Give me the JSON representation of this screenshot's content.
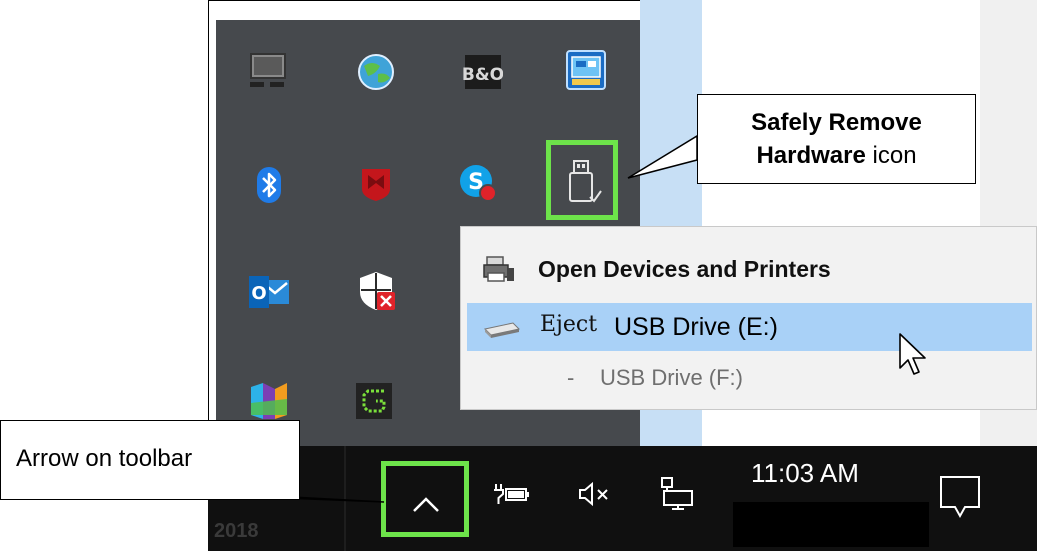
{
  "tray": {
    "icons": [
      "monitor-icon",
      "globe-icon",
      "bo-audio-icon",
      "intel-graphics-icon",
      "bluetooth-icon",
      "mcafee-icon",
      "skype-icon",
      "usb-drive-icon",
      "outlook-icon",
      "security-shield-icon",
      "maps-icon",
      "greenshot-icon"
    ],
    "bo_text": "B&O",
    "outlook_text": "O"
  },
  "menu": {
    "open_devices_label": "Open Devices and Printers",
    "eject_word": "Eject",
    "eject_drive_label": "USB Drive (E:)",
    "f_dash": "-",
    "f_drive_label": "USB Drive (F:)"
  },
  "callouts": {
    "safely_remove_bold": "Safely Remove",
    "hardware_bold": "Hardware",
    "icon_word": " icon",
    "arrow_on_toolbar": "Arrow on toolbar"
  },
  "taskbar": {
    "clock_time": "11:03 AM",
    "year": "2018",
    "icons": [
      "chevron-up-icon",
      "battery-power-icon",
      "volume-muted-icon",
      "network-icon",
      "action-center-icon"
    ]
  },
  "colors": {
    "highlight": "#6de34a",
    "tray_background": "#46494d",
    "taskbar_background": "#101010",
    "menu_selection": "#a9d1f7"
  }
}
